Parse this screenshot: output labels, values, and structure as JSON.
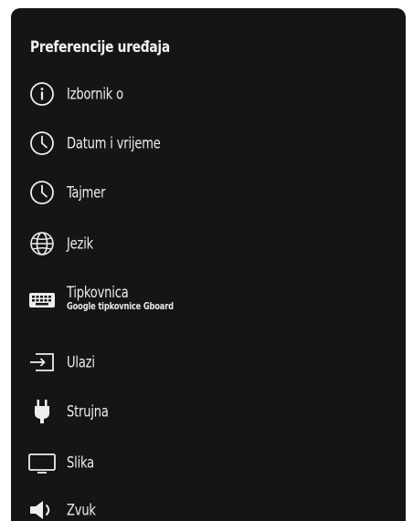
{
  "header": {
    "title": "Preferencije uređaja"
  },
  "menu": {
    "items": [
      {
        "label": "Izbornik o",
        "icon": "info-icon"
      },
      {
        "label": "Datum i vrijeme",
        "icon": "clock-icon"
      },
      {
        "label": "Tajmer",
        "icon": "clock-icon"
      },
      {
        "label": "Jezik",
        "icon": "globe-icon"
      },
      {
        "label": "Tipkovnica",
        "sublabel": "Google tipkovnice Gboard",
        "icon": "keyboard-icon"
      },
      {
        "label": "Ulazi",
        "icon": "input-icon"
      },
      {
        "label": "Strujna",
        "icon": "plug-icon"
      },
      {
        "label": "Slika",
        "icon": "screen-icon"
      },
      {
        "label": "Zvuk",
        "icon": "speaker-icon"
      }
    ]
  },
  "colors": {
    "panel_background": "#151515",
    "text": "#eeeeee",
    "page_background": "#ffffff"
  }
}
